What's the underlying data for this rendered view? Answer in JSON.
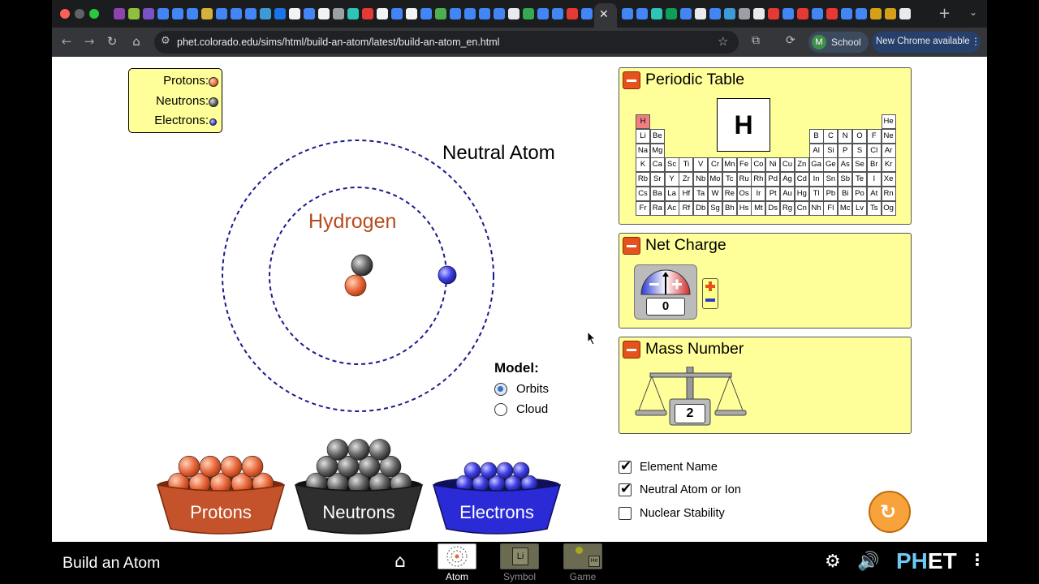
{
  "browser": {
    "url": "phet.colorado.edu/sims/html/build-an-atom/latest/build-an-atom_en.html",
    "profile_initial": "M",
    "profile_label": "School",
    "update_label": "New Chrome available",
    "active_tab_close": "✕",
    "new_tab": "+",
    "tab_favicon_colors": [
      "#8e44ad",
      "#8fbf3f",
      "#7b52c4",
      "#4285f4",
      "#4285f4",
      "#4285f4",
      "#d3b13a",
      "#4285f4",
      "#4285f4",
      "#4285f4",
      "#3c9bd6",
      "#1a73e8",
      "#f1f3f4",
      "#4285f4",
      "#f1f3f4",
      "#9aa0a6",
      "#2ec4b6",
      "#e53935",
      "#f1f3f4",
      "#4285f4",
      "#f1f3f4",
      "#4285f4",
      "#4caf50",
      "#4285f4",
      "#4285f4",
      "#4285f4",
      "#4285f4",
      "#e8eaed",
      "#34a853",
      "#4285f4",
      "#4285f4",
      "#e53935",
      "#4285f4",
      "#4285f4",
      "#4285f4",
      "#2ec4b6",
      "#0f9d58",
      "#4285f4",
      "#e8eaed",
      "#4285f4",
      "#3c9bd6",
      "#9aa0a6",
      "#e8eaed",
      "#e53935",
      "#4285f4",
      "#e53935",
      "#4285f4",
      "#e53935",
      "#4285f4",
      "#4285f4",
      "#d4a017",
      "#d4a017",
      "#e8eaed"
    ]
  },
  "sim": {
    "legend": {
      "protons_label": "Protons:",
      "neutrons_label": "Neutrons:",
      "electrons_label": "Electrons:"
    },
    "atom": {
      "neutral_label": "Neutral Atom",
      "element_name": "Hydrogen",
      "protons": 1,
      "neutrons": 1,
      "electrons": 1
    },
    "model": {
      "title": "Model:",
      "options": [
        "Orbits",
        "Cloud"
      ],
      "selected": "Orbits"
    },
    "buckets": {
      "protons": "Protons",
      "neutrons": "Neutrons",
      "electrons": "Electrons"
    },
    "periodic_table": {
      "title": "Periodic Table",
      "selected_symbol": "H",
      "rows": [
        [
          "H",
          "",
          "",
          "",
          "",
          "",
          "",
          "",
          "",
          "",
          "",
          "",
          "",
          "",
          "",
          "",
          "",
          "He"
        ],
        [
          "Li",
          "Be",
          "",
          "",
          "",
          "",
          "",
          "",
          "",
          "",
          "",
          "",
          "B",
          "C",
          "N",
          "O",
          "F",
          "Ne"
        ],
        [
          "Na",
          "Mg",
          "",
          "",
          "",
          "",
          "",
          "",
          "",
          "",
          "",
          "",
          "Al",
          "Si",
          "P",
          "S",
          "Cl",
          "Ar"
        ],
        [
          "K",
          "Ca",
          "Sc",
          "Ti",
          "V",
          "Cr",
          "Mn",
          "Fe",
          "Co",
          "Ni",
          "Cu",
          "Zn",
          "Ga",
          "Ge",
          "As",
          "Se",
          "Br",
          "Kr"
        ],
        [
          "Rb",
          "Sr",
          "Y",
          "Zr",
          "Nb",
          "Mo",
          "Tc",
          "Ru",
          "Rh",
          "Pd",
          "Ag",
          "Cd",
          "In",
          "Sn",
          "Sb",
          "Te",
          "I",
          "Xe"
        ],
        [
          "Cs",
          "Ba",
          "La",
          "Hf",
          "Ta",
          "W",
          "Re",
          "Os",
          "Ir",
          "Pt",
          "Au",
          "Hg",
          "Tl",
          "Pb",
          "Bi",
          "Po",
          "At",
          "Rn"
        ],
        [
          "Fr",
          "Ra",
          "Ac",
          "Rf",
          "Db",
          "Sg",
          "Bh",
          "Hs",
          "Mt",
          "Ds",
          "Rg",
          "Cn",
          "Nh",
          "Fl",
          "Mc",
          "Lv",
          "Ts",
          "Og"
        ]
      ]
    },
    "net_charge": {
      "title": "Net Charge",
      "value": "0"
    },
    "mass_number": {
      "title": "Mass Number",
      "value": "2"
    },
    "checkboxes": [
      {
        "label": "Element Name",
        "checked": true
      },
      {
        "label": "Neutral Atom or Ion",
        "checked": true
      },
      {
        "label": "Nuclear Stability",
        "checked": false
      }
    ],
    "colors": {
      "proton": "#e8653a",
      "neutron": "#555555",
      "electron": "#3f3fe6",
      "panel": "#ffff99",
      "orbit": "#1a1a8c"
    }
  },
  "navbar": {
    "title": "Build an Atom",
    "screens": [
      {
        "label": "Atom",
        "active": true
      },
      {
        "label": "Symbol",
        "active": false
      },
      {
        "label": "Game",
        "active": false
      }
    ],
    "symbol_thumb_text": "Li",
    "game_thumb_text": "He",
    "logo_a": "PH",
    "logo_b": "ET"
  }
}
